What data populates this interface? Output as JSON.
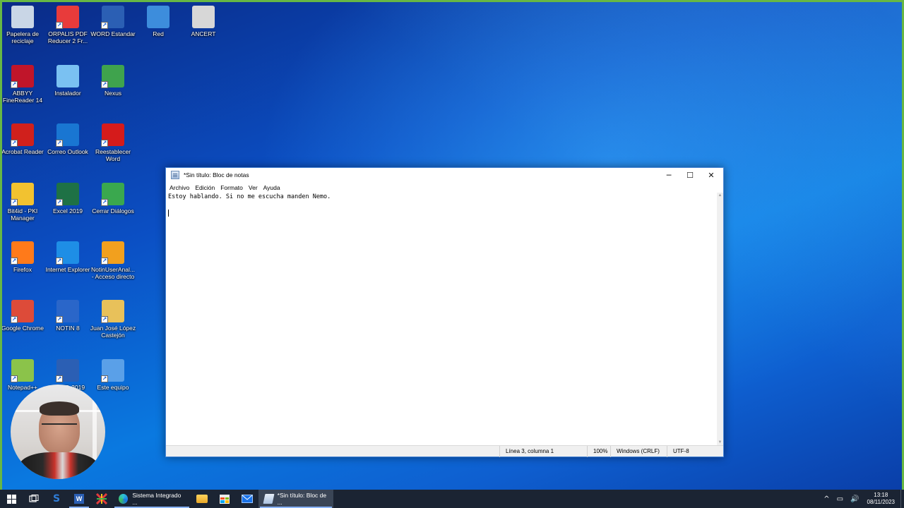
{
  "desktop": {
    "icons": [
      {
        "label": "Papelera de reciclaje",
        "icon": "recycle-bin-icon",
        "color": "#c9d6e6"
      },
      {
        "label": "ORPALIS PDF Reducer 2 Fr...",
        "icon": "pdf-reducer-icon",
        "color": "#e83b3b"
      },
      {
        "label": "WORD Estandar",
        "icon": "word-icon",
        "color": "#2b5fb4"
      },
      {
        "label": "Red",
        "icon": "network-icon",
        "color": "#3d8ddc"
      },
      {
        "label": "ANCERT",
        "icon": "ancert-icon",
        "color": "#d7d7d7"
      },
      {
        "label": "ABBYY FineReader 14",
        "icon": "abbyy-icon",
        "color": "#c0152a"
      },
      {
        "label": "Instalador",
        "icon": "installer-icon",
        "color": "#7ac1f2"
      },
      {
        "label": "Nexus",
        "icon": "nexus-icon",
        "color": "#3fa34d"
      },
      {
        "label": "Acrobat Reader",
        "icon": "acrobat-icon",
        "color": "#d0201c"
      },
      {
        "label": "Correo Outlook",
        "icon": "outlook-icon",
        "color": "#1976d2"
      },
      {
        "label": "Reestablecer Word",
        "icon": "reset-word-icon",
        "color": "#d51b1b"
      },
      {
        "label": "Bit4id - PKI Manager",
        "icon": "bit4id-icon",
        "color": "#f2c230"
      },
      {
        "label": "Excel 2019",
        "icon": "excel-icon",
        "color": "#1e7145"
      },
      {
        "label": "Cerrar Diálogos",
        "icon": "close-dialogs-icon",
        "color": "#3aa84e"
      },
      {
        "label": "Firefox",
        "icon": "firefox-icon",
        "color": "#ff7a1a"
      },
      {
        "label": "Internet Explorer",
        "icon": "internet-explorer-icon",
        "color": "#1e8ee6"
      },
      {
        "label": "NotinUserAnal... - Acceso directo",
        "icon": "notin-user-icon",
        "color": "#f2a01e"
      },
      {
        "label": "Google Chrome",
        "icon": "chrome-icon",
        "color": "#dd4b39"
      },
      {
        "label": "NOTIN 8",
        "icon": "notin-icon",
        "color": "#2a66c9"
      },
      {
        "label": "Juan José López Castejón",
        "icon": "user-folder-icon",
        "color": "#e8c15a"
      },
      {
        "label": "Notepad++",
        "icon": "notepadpp-icon",
        "color": "#8bc34a"
      },
      {
        "label": "WORD 2019",
        "icon": "word-2019-icon",
        "color": "#2b5fb4"
      },
      {
        "label": "Este equipo",
        "icon": "this-pc-icon",
        "color": "#5aa0e8"
      }
    ]
  },
  "notepad": {
    "title": "*Sin título: Bloc de notas",
    "menu": [
      "Archivo",
      "Edición",
      "Formato",
      "Ver",
      "Ayuda"
    ],
    "lines": [
      "Estoy hablando. Si no me escucha manden Nemo.",
      ""
    ],
    "status": {
      "position": "Línea 3, columna 1",
      "zoom": "100%",
      "line_ending": "Windows (CRLF)",
      "encoding": "UTF-8"
    },
    "controls": {
      "minimize": "─",
      "maximize": "☐",
      "close": "✕"
    }
  },
  "taskbar": {
    "apps": [
      {
        "label": "Sistema Integrado ...",
        "icon": "edge-icon",
        "active": false
      },
      {
        "label": "*Sin título: Bloc de ...",
        "icon": "notepad-icon",
        "active": true
      }
    ],
    "clock": {
      "time": "13:18",
      "date": "08/11/2023"
    }
  }
}
